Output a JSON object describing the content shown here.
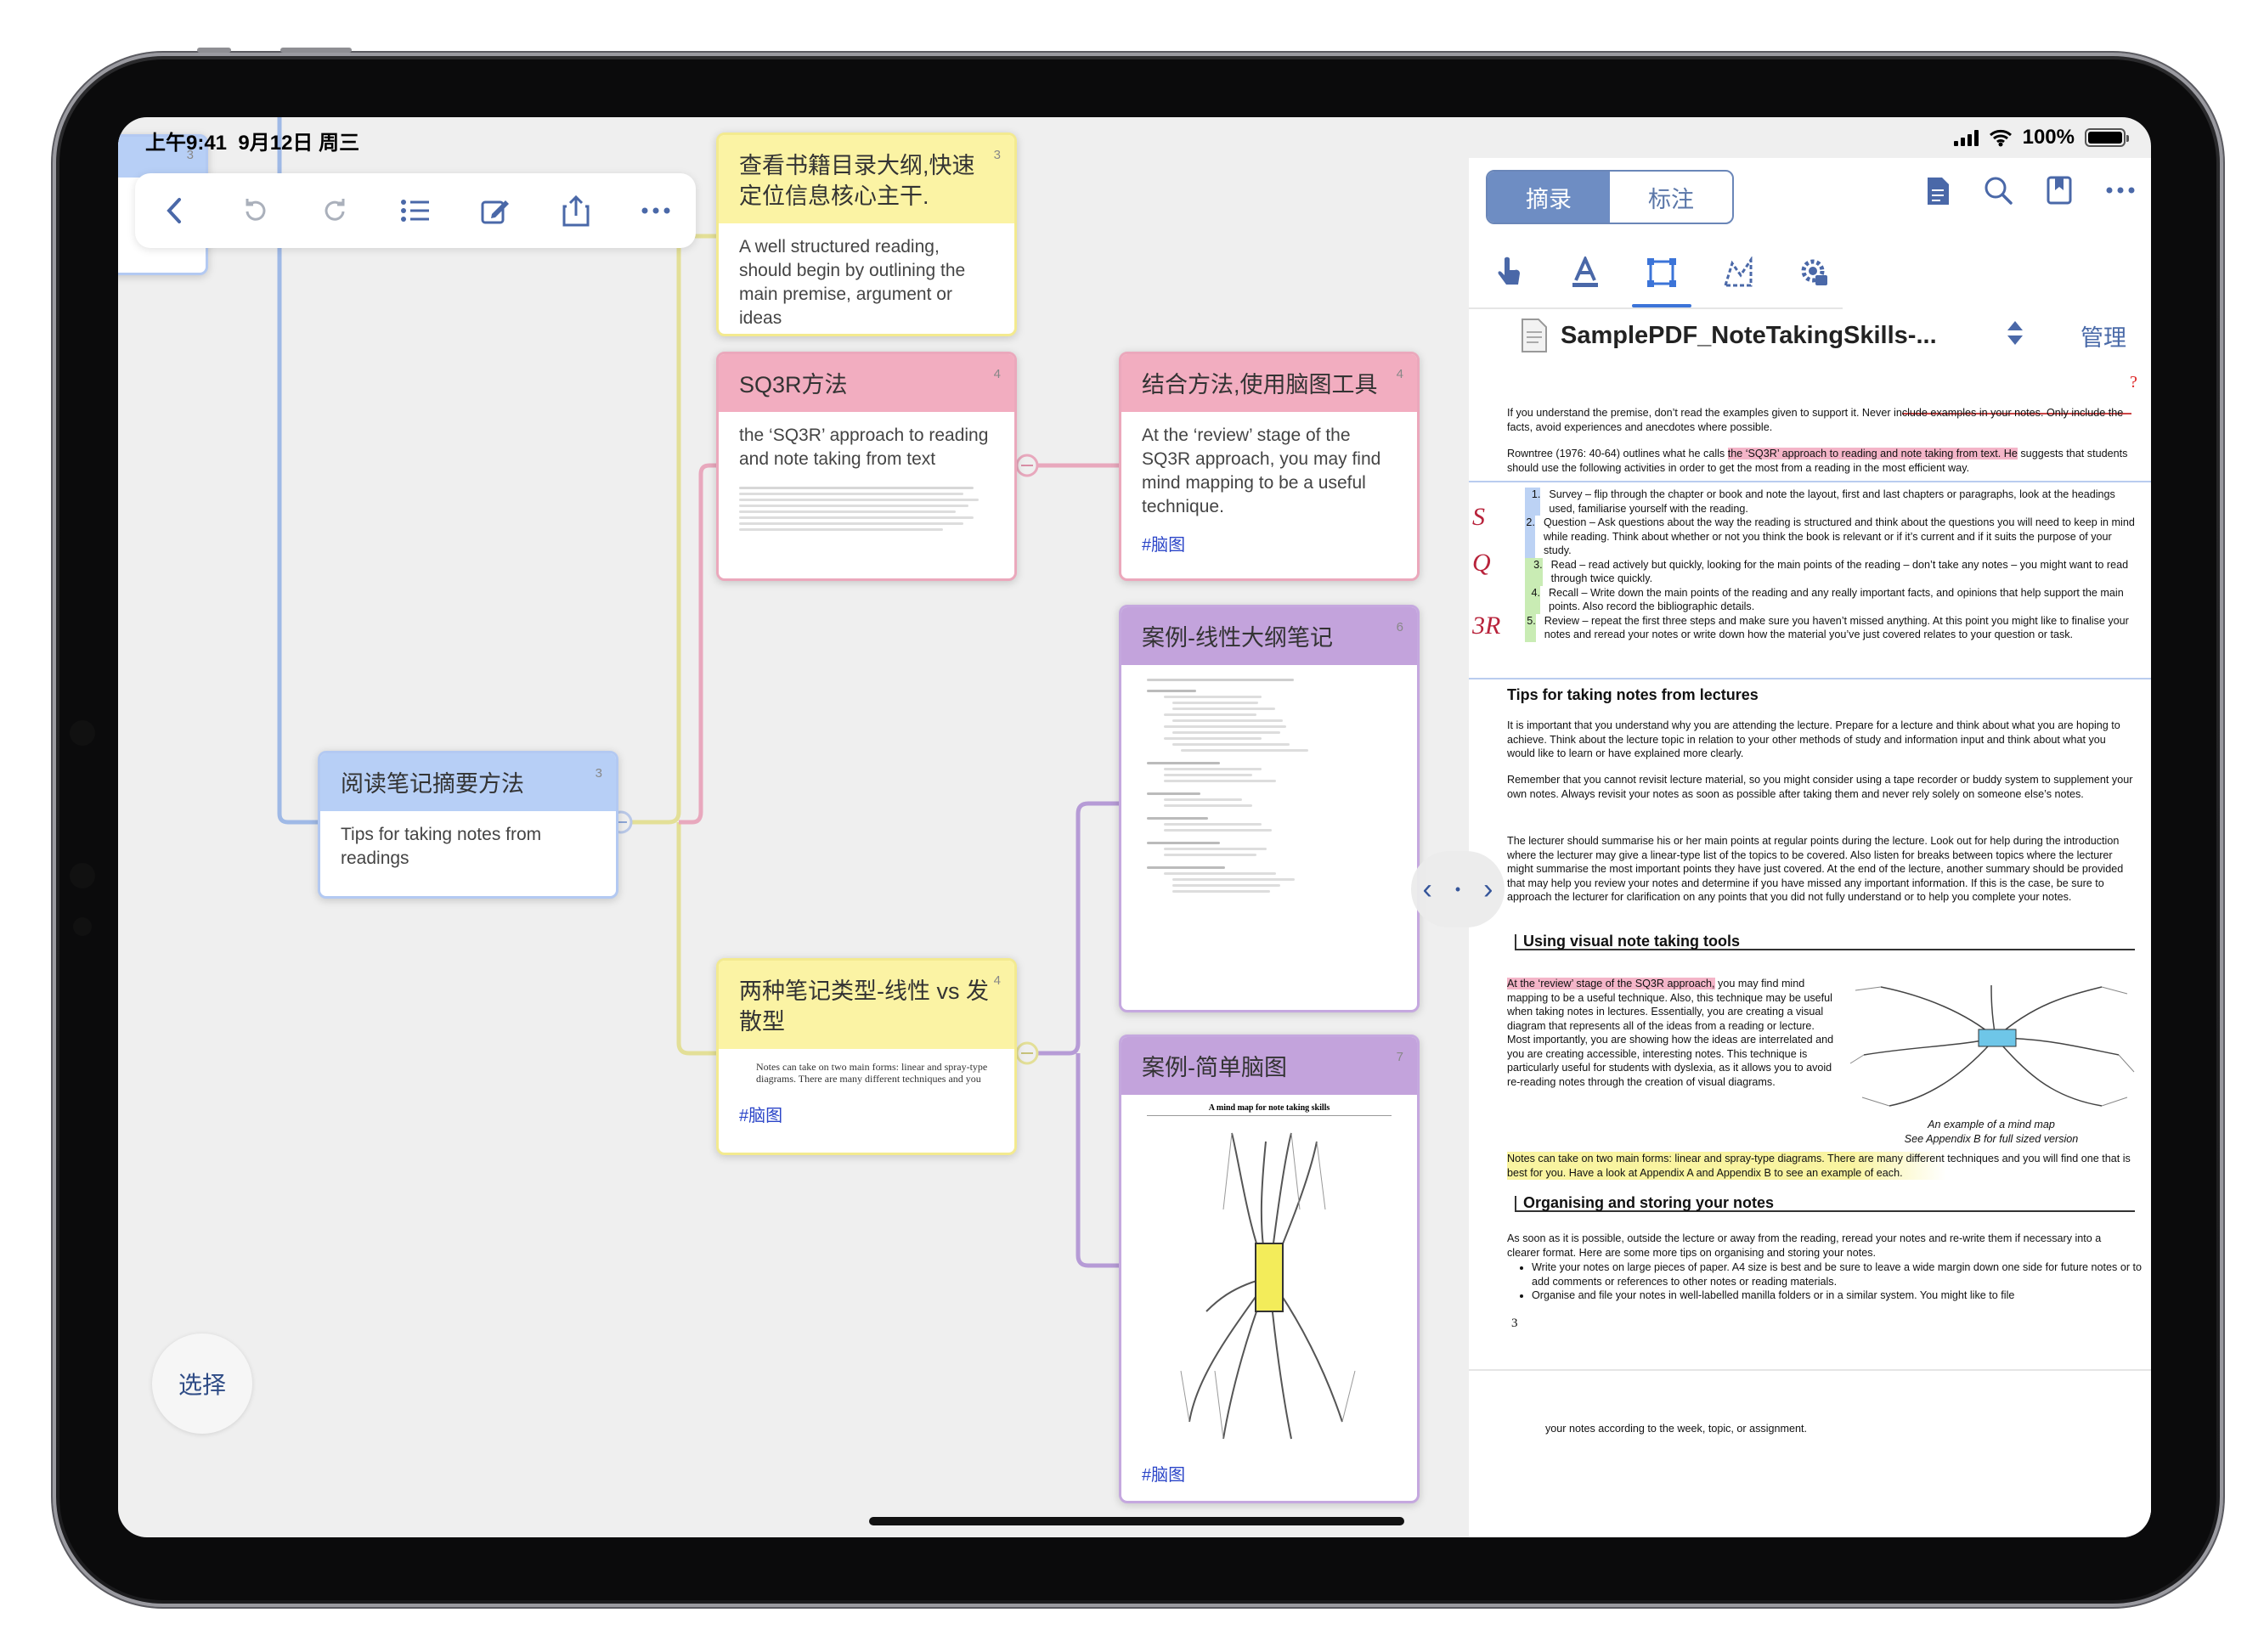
{
  "status": {
    "time": "上午9:41",
    "date": "9月12日 周三",
    "battery": "100%"
  },
  "toolbar": {
    "icons": [
      "back-icon",
      "undo-icon",
      "redo-icon",
      "outline-list-icon",
      "edit-icon",
      "share-icon",
      "more-icon"
    ]
  },
  "mindmap": {
    "root": {
      "number": "3",
      "title": "阅读笔记摘要方法",
      "body": "Tips for taking notes from readings"
    },
    "card_outline": {
      "number": "3",
      "title": "查看书籍目录大纲,快速定位信息核心主干.",
      "body": "A well structured reading, should begin by outlining the main premise, argument or ideas"
    },
    "card_sq3r": {
      "number": "4",
      "title": "SQ3R方法",
      "body": "the ‘SQ3R’ approach to reading and note taking from text"
    },
    "card_combine": {
      "number": "4",
      "title": "结合方法,使用脑图工具",
      "body": "At the ‘review’ stage of the SQ3R approach, you may find mind mapping to be a useful technique.",
      "tag": "#脑图"
    },
    "card_types": {
      "number": "4",
      "title": "两种笔记类型-线性 vs 发散型",
      "body": "Notes can take on two main forms: linear and spray-type diagrams. There are many different techniques and you",
      "tag": "#脑图"
    },
    "card_linear": {
      "number": "6",
      "title": "案例-线性大纲笔记"
    },
    "card_simple": {
      "number": "7",
      "title": "案例-简单脑图",
      "tag": "#脑图",
      "preview_title": "A mind map for note taking skills"
    },
    "hidden_number": "3"
  },
  "select_button": "选择",
  "panel": {
    "tabs": [
      "摘录",
      "标注"
    ],
    "doc_title": "SamplePDF_NoteTakingSkills-...",
    "manage": "管理",
    "icons": [
      "document-icon",
      "search-icon",
      "bookmark-icon",
      "more-icon"
    ],
    "tools": [
      "hand-pointer-icon",
      "text-highlight-icon",
      "rectangle-select-icon",
      "lasso-icon",
      "settings-icon"
    ]
  },
  "pdf": {
    "para1": "If you understand the premise, don’t read the examples given to support it.  Never include examples in your notes.  Only include the facts, avoid experiences and anecdotes where possible.",
    "para2a": "Rowntree (1976: 40-64) outlines what he calls ",
    "para2b": "the ‘SQ3R’ approach to reading and note taking from text.  He",
    "para2c": " suggests that students should use the following activities in order to get the most from a reading in the most efficient way.",
    "list": [
      {
        "n": "1.",
        "text": "Survey – flip through the chapter or book and note the layout, first and last chapters or paragraphs, look at the headings used, familiarise yourself with the reading."
      },
      {
        "n": "2.",
        "text": "Question – Ask questions about the way the reading is structured and think about the questions you will need to keep in mind while reading.  Think about whether or not you think the book is relevant or if it’s current and if it suits the purpose of your study."
      },
      {
        "n": "3.",
        "text": "Read – read actively but quickly, looking for the main points of the reading – don’t take any notes – you might want to read through twice quickly."
      },
      {
        "n": "4.",
        "text": "Recall – Write down the main points of the reading and any really important facts, and opinions that help support the main points.  Also record the bibliographic details."
      },
      {
        "n": "5.",
        "text": "Review – repeat the first three steps and make sure you haven’t missed anything.  At this point you might like to finalise your notes and reread your notes or write down how the material you’ve just covered relates to your question or task."
      }
    ],
    "h_lectures": "Tips for taking notes from lectures",
    "lect1": "It is important that you understand why you are attending the lecture.  Prepare for a lecture and think about what you are hoping to achieve.  Think about the lecture topic in relation to your other methods of study and information input and think about what you would like to learn or have explained more clearly.",
    "lect2": "Remember that you cannot revisit lecture material, so you might consider using a tape recorder or buddy system to supplement your own notes.  Always revisit your notes as soon as possible after taking them and never rely solely on someone else’s notes.",
    "lect3": "The lecturer should summarise his or her main points at regular points during the lecture.  Look out for help during the introduction where the lecturer may give a linear-type list of the topics to be covered.  Also listen for breaks between topics where the lecturer might summarise the most important points they have just covered.  At the end of the lecture, another summary should be provided that may help you review your notes and determine if you have missed any important information.  If this is the case, be sure to approach the lecturer for clarification on any points that you did not fully understand or to help you complete your notes.",
    "h_visual": "Using visual note taking tools",
    "vis_hl": "At the ‘review’ stage of the SQ3R approach,",
    "vis_rest": " you may find mind mapping to be a useful technique.  Also, this technique may be useful when taking notes in lectures.  Essentially, you are creating a visual diagram that represents all of the ideas from a reading or lecture.  Most importantly, you are showing how the ideas are interrelated and you are creating accessible, interesting notes.  This technique is particularly useful for students with dyslexia, as it allows you to avoid re-reading notes through the creation of visual diagrams.",
    "caption1": "An example of a mind map",
    "caption2": "See Appendix B for full sized version",
    "forms": "Notes can take on two main forms: linear and spray-type diagrams.  There are many different techniques and you will find one that is best for you.  Have a look at Appendix A and Appendix B to see an example of each.",
    "h_storing": "Organising and storing your notes",
    "store1": "As soon as it is possible, outside the lecture or away from the reading, reread your notes and re-write them if necessary into a clearer format.  Here are some more tips on organising and storing your notes.",
    "bullets": [
      "Write your notes on large pieces of paper.  A4 size is best and be sure to leave a wide margin down one side for future notes or to add comments or references to other notes or reading materials.",
      "Organise and file your notes in well-labelled manilla folders or in a similar system.  You might like to file"
    ],
    "page_no": "3",
    "next_page": "your notes according to the week, topic, or assignment.",
    "margin_marks": [
      "S",
      "Q",
      "3R"
    ]
  },
  "colors": {
    "yellow": "#fbf3a4",
    "pink": "#f2adc0",
    "purple": "#c3a3dc",
    "blue": "#b7cff6",
    "accent": "#3c74d8"
  }
}
